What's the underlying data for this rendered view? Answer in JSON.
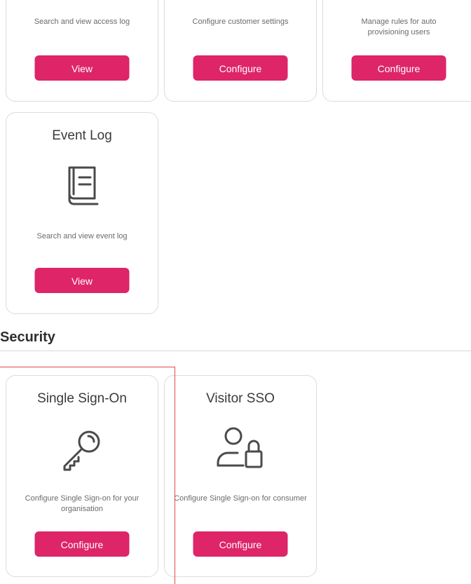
{
  "cards_top": [
    {
      "desc": "Search and view access log",
      "button": "View"
    },
    {
      "desc": "Configure customer settings",
      "button": "Configure"
    },
    {
      "desc": "Manage rules for auto provisioning users",
      "button": "Configure"
    }
  ],
  "event_log": {
    "title": "Event Log",
    "icon": "book-icon",
    "desc": "Search and view event log",
    "button": "View"
  },
  "security": {
    "title": "Security",
    "cards": [
      {
        "title": "Single Sign-On",
        "icon": "key-icon",
        "desc": "Configure Single Sign-on for your organisation",
        "button": "Configure"
      },
      {
        "title": "Visitor SSO",
        "icon": "user-lock-icon",
        "desc": "Configure Single Sign-on for consumer",
        "button": "Configure"
      }
    ]
  },
  "colors": {
    "accent": "#dd2568",
    "highlight": "#e04a4a"
  }
}
